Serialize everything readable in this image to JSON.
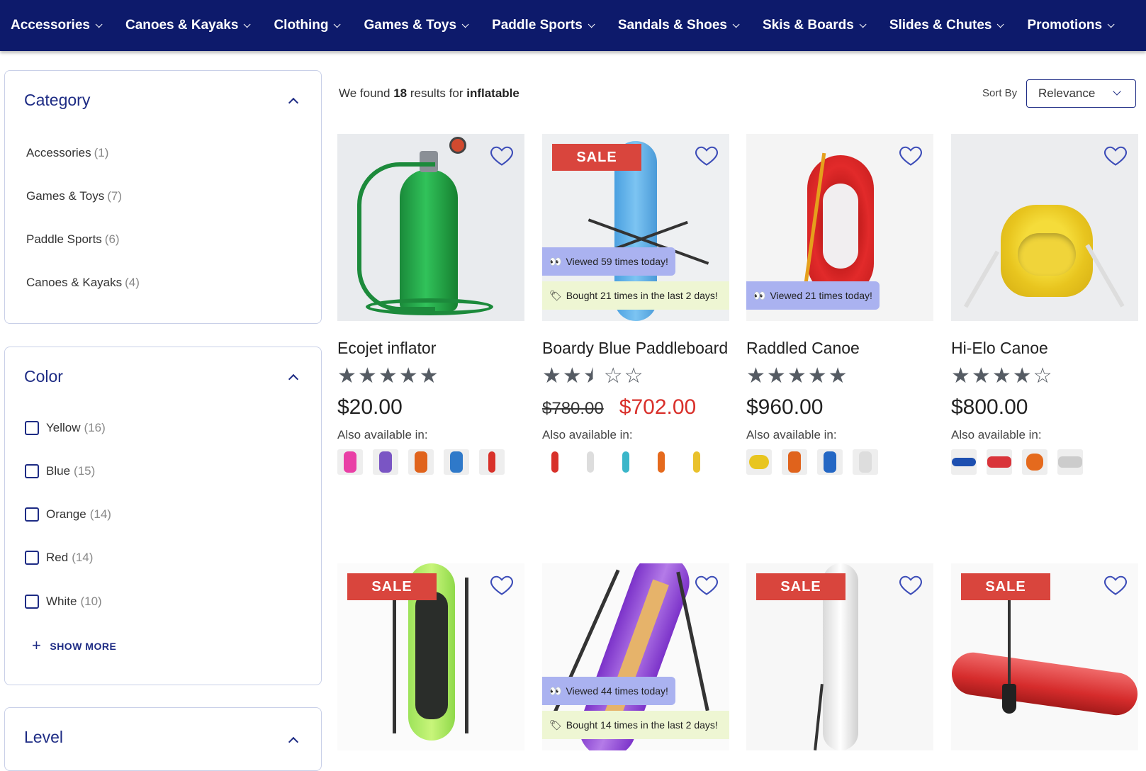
{
  "nav": [
    {
      "label": "Accessories"
    },
    {
      "label": "Canoes & Kayaks"
    },
    {
      "label": "Clothing"
    },
    {
      "label": "Games & Toys"
    },
    {
      "label": "Paddle Sports"
    },
    {
      "label": "Sandals & Shoes"
    },
    {
      "label": "Skis & Boards"
    },
    {
      "label": "Slides & Chutes"
    },
    {
      "label": "Promotions"
    }
  ],
  "sidebar": {
    "category": {
      "title": "Category",
      "items": [
        {
          "label": "Accessories",
          "count": "(1)"
        },
        {
          "label": "Games & Toys",
          "count": "(7)"
        },
        {
          "label": "Paddle Sports",
          "count": "(6)"
        },
        {
          "label": "Canoes & Kayaks",
          "count": "(4)"
        }
      ]
    },
    "color": {
      "title": "Color",
      "items": [
        {
          "label": "Yellow",
          "count": "(16)"
        },
        {
          "label": "Blue",
          "count": "(15)"
        },
        {
          "label": "Orange",
          "count": "(14)"
        },
        {
          "label": "Red",
          "count": "(14)"
        },
        {
          "label": "White",
          "count": "(10)"
        }
      ],
      "show_more": "SHOW MORE"
    },
    "level": {
      "title": "Level"
    }
  },
  "results": {
    "prefix": "We found",
    "count": "18",
    "middle": "results for",
    "query": "inflatable"
  },
  "sort": {
    "label": "Sort By",
    "value": "Relevance"
  },
  "products": [
    {
      "name": "Ecojet inflator",
      "rating": 5,
      "price": "$20.00",
      "avail_label": "Also available in:",
      "swatch_colors": [
        "#e93fa6",
        "#7a55c4",
        "#e0631c",
        "#2f79c9",
        "#d8312a"
      ]
    },
    {
      "name": "Boardy Blue Paddleboard",
      "rating": 2.5,
      "sale": "SALE",
      "viewed": "Viewed 59 times today!",
      "bought": "Bought 21 times in the last 2 days!",
      "old_price": "$780.00",
      "price": "$702.00",
      "avail_label": "Also available in:",
      "swatch_colors": [
        "#d8312a",
        "#dddddd",
        "#3bb6c9",
        "#e56a1d",
        "#e9c12c"
      ]
    },
    {
      "name": "Raddled Canoe",
      "rating": 5,
      "viewed": "Viewed 21 times today!",
      "price": "$960.00",
      "avail_label": "Also available in:",
      "swatch_colors": [
        "#e8c51f",
        "#e0631c",
        "#2467c4",
        "#dddddd"
      ]
    },
    {
      "name": "Hi-Elo Canoe",
      "rating": 4,
      "price": "$800.00",
      "avail_label": "Also available in:",
      "swatch_colors": [
        "#1d4fb0",
        "#d9343a",
        "#e56a1d",
        "#cccccc"
      ]
    },
    {
      "sale": "SALE"
    },
    {
      "viewed": "Viewed 44 times today!",
      "bought": "Bought 14 times in the last 2 days!"
    },
    {
      "sale": "SALE"
    },
    {
      "sale": "SALE"
    }
  ],
  "colors": {
    "nav_bg": "#0d1a6b",
    "accent": "#1d2b84",
    "sale": "#d9453d",
    "price_sale": "#d9302b",
    "viewed_badge": "#aab2f0",
    "bought_badge": "#eef6d3"
  }
}
